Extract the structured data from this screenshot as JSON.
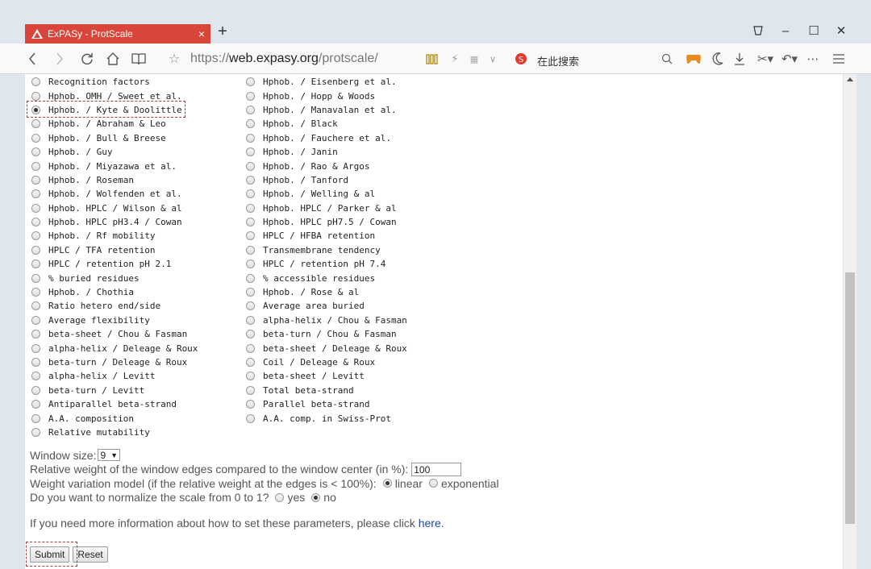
{
  "browser": {
    "tab_title": "ExPASy - ProtScale",
    "url_scheme": "https://",
    "url_host": "web.expasy.org",
    "url_path": "/protscale/",
    "search_placeholder": "在此搜索",
    "new_tab": "+",
    "close": "×",
    "minimize": "–",
    "maximize": "☐",
    "window_close": "✕"
  },
  "scales": {
    "left": [
      {
        "label": "Recognition factors",
        "checked": false
      },
      {
        "label": "Hphob. OMH / Sweet et al.",
        "checked": false
      },
      {
        "label": "Hphob. / Kyte & Doolittle",
        "checked": true
      },
      {
        "label": "Hphob. / Abraham & Leo",
        "checked": false
      },
      {
        "label": "Hphob. / Bull & Breese",
        "checked": false
      },
      {
        "label": "Hphob. / Guy",
        "checked": false
      },
      {
        "label": "Hphob. / Miyazawa et al.",
        "checked": false
      },
      {
        "label": "Hphob. / Roseman",
        "checked": false
      },
      {
        "label": "Hphob. / Wolfenden et al.",
        "checked": false
      },
      {
        "label": "Hphob. HPLC / Wilson & al",
        "checked": false
      },
      {
        "label": "Hphob. HPLC pH3.4 / Cowan",
        "checked": false
      },
      {
        "label": "Hphob. / Rf mobility",
        "checked": false
      },
      {
        "label": "HPLC / TFA retention",
        "checked": false
      },
      {
        "label": "HPLC / retention pH 2.1",
        "checked": false
      },
      {
        "label": "% buried residues",
        "checked": false
      },
      {
        "label": "Hphob. / Chothia",
        "checked": false
      },
      {
        "label": "Ratio hetero end/side",
        "checked": false
      },
      {
        "label": "Average flexibility",
        "checked": false
      },
      {
        "label": "beta-sheet / Chou & Fasman",
        "checked": false
      },
      {
        "label": "alpha-helix / Deleage & Roux",
        "checked": false
      },
      {
        "label": "beta-turn / Deleage & Roux",
        "checked": false
      },
      {
        "label": "alpha-helix / Levitt",
        "checked": false
      },
      {
        "label": "beta-turn / Levitt",
        "checked": false
      },
      {
        "label": "Antiparallel beta-strand",
        "checked": false
      },
      {
        "label": "A.A. composition",
        "checked": false
      },
      {
        "label": "Relative mutability",
        "checked": false
      }
    ],
    "right": [
      {
        "label": "Hphob. / Eisenberg et al.",
        "checked": false
      },
      {
        "label": "Hphob. / Hopp & Woods",
        "checked": false
      },
      {
        "label": "Hphob. / Manavalan et al.",
        "checked": false
      },
      {
        "label": "Hphob. / Black",
        "checked": false
      },
      {
        "label": "Hphob. / Fauchere et al.",
        "checked": false
      },
      {
        "label": "Hphob. / Janin",
        "checked": false
      },
      {
        "label": "Hphob. / Rao & Argos",
        "checked": false
      },
      {
        "label": "Hphob. / Tanford",
        "checked": false
      },
      {
        "label": "Hphob. / Welling & al",
        "checked": false
      },
      {
        "label": "Hphob. HPLC / Parker & al",
        "checked": false
      },
      {
        "label": "Hphob. HPLC pH7.5 / Cowan",
        "checked": false
      },
      {
        "label": "HPLC / HFBA retention",
        "checked": false
      },
      {
        "label": "Transmembrane tendency",
        "checked": false
      },
      {
        "label": "HPLC / retention pH 7.4",
        "checked": false
      },
      {
        "label": "% accessible residues",
        "checked": false
      },
      {
        "label": "Hphob. / Rose & al",
        "checked": false
      },
      {
        "label": "Average area buried",
        "checked": false
      },
      {
        "label": "alpha-helix / Chou & Fasman",
        "checked": false
      },
      {
        "label": "beta-turn / Chou & Fasman",
        "checked": false
      },
      {
        "label": "beta-sheet / Deleage & Roux",
        "checked": false
      },
      {
        "label": "Coil / Deleage & Roux",
        "checked": false
      },
      {
        "label": "beta-sheet / Levitt",
        "checked": false
      },
      {
        "label": "Total beta-strand",
        "checked": false
      },
      {
        "label": "Parallel beta-strand",
        "checked": false
      },
      {
        "label": "A.A. comp. in Swiss-Prot",
        "checked": false
      }
    ]
  },
  "params": {
    "window_size_label": "Window size:",
    "window_size_value": "9",
    "edge_weight_label": "Relative weight of the window edges compared to the window center (in %):",
    "edge_weight_value": "100",
    "variation_label": "Weight variation model (if the relative weight at the edges is < 100%):",
    "variation_linear": "linear",
    "variation_exponential": "exponential",
    "normalize_label": "Do you want to normalize the scale from 0 to 1?",
    "normalize_yes": "yes",
    "normalize_no": "no",
    "info_text": "If you need more information about how to set these parameters, please click",
    "info_link": "here",
    "info_end": "."
  },
  "buttons": {
    "submit": "Submit",
    "reset": "Reset"
  },
  "colors": {
    "tab_red": "#d9453b",
    "annotation_red": "#b03a3a",
    "link_blue": "#1a4aa0"
  }
}
